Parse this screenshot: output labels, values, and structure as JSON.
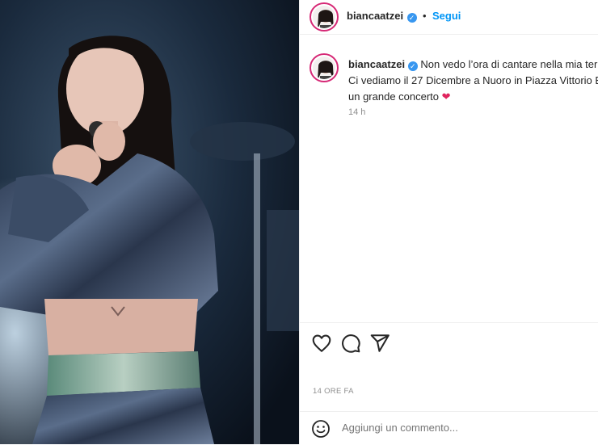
{
  "post": {
    "username": "biancaatzei",
    "follow_label": "Segui",
    "caption_line_1": "Non vedo l’ora di cantare nella mia terra",
    "caption_line_2": "Ci vediamo il 27 Dicembre a Nuoro in Piazza Vittorio E",
    "caption_line_3": "un grande concerto",
    "caption_emoji": "❤",
    "relative_time": "14 h",
    "date_label": "14 ORE FA",
    "comment_placeholder": "Aggiungi un commento..."
  },
  "icons": {
    "verified": "verified-badge-icon",
    "like": "heart-icon",
    "comment": "comment-bubble-icon",
    "share": "paper-plane-icon",
    "emoji": "smiley-icon"
  },
  "colors": {
    "follow_blue": "#0095f6",
    "verified_blue": "#3897f0",
    "heart_red": "#e0245e",
    "avatar_ring": "#d62976",
    "muted_text": "#8e8e8e"
  }
}
